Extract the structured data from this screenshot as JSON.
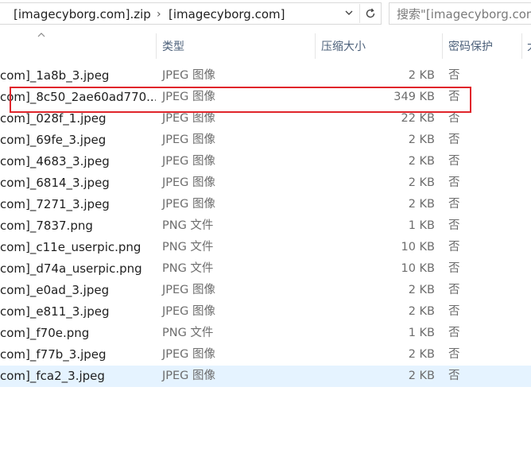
{
  "address_bar": {
    "crumbs": [
      "[imagecyborg.com].zip",
      "[imagecyborg.com]"
    ],
    "separator": "›",
    "dropdown_icon": "chevron-down-icon",
    "refresh_icon": "refresh-icon"
  },
  "search": {
    "placeholder": "搜索\"[imagecyborg.com]\""
  },
  "columns": {
    "type": "类型",
    "compressed_size": "压缩大小",
    "password": "密码保护",
    "extra": "大"
  },
  "files": [
    {
      "name": "com]_1a8b_3.jpeg",
      "type": "JPEG 图像",
      "size": "2 KB",
      "password": "否"
    },
    {
      "name": "com]_8c50_2ae60ad770...",
      "type": "JPEG 图像",
      "size": "349 KB",
      "password": "否"
    },
    {
      "name": "com]_028f_1.jpeg",
      "type": "JPEG 图像",
      "size": "22 KB",
      "password": "否"
    },
    {
      "name": "com]_69fe_3.jpeg",
      "type": "JPEG 图像",
      "size": "2 KB",
      "password": "否"
    },
    {
      "name": "com]_4683_3.jpeg",
      "type": "JPEG 图像",
      "size": "2 KB",
      "password": "否"
    },
    {
      "name": "com]_6814_3.jpeg",
      "type": "JPEG 图像",
      "size": "2 KB",
      "password": "否"
    },
    {
      "name": "com]_7271_3.jpeg",
      "type": "JPEG 图像",
      "size": "2 KB",
      "password": "否"
    },
    {
      "name": "com]_7837.png",
      "type": "PNG 文件",
      "size": "1 KB",
      "password": "否"
    },
    {
      "name": "com]_c11e_userpic.png",
      "type": "PNG 文件",
      "size": "10 KB",
      "password": "否"
    },
    {
      "name": "com]_d74a_userpic.png",
      "type": "PNG 文件",
      "size": "10 KB",
      "password": "否"
    },
    {
      "name": "com]_e0ad_3.jpeg",
      "type": "JPEG 图像",
      "size": "2 KB",
      "password": "否"
    },
    {
      "name": "com]_e811_3.jpeg",
      "type": "JPEG 图像",
      "size": "2 KB",
      "password": "否"
    },
    {
      "name": "com]_f70e.png",
      "type": "PNG 文件",
      "size": "1 KB",
      "password": "否"
    },
    {
      "name": "com]_f77b_3.jpeg",
      "type": "JPEG 图像",
      "size": "2 KB",
      "password": "否"
    },
    {
      "name": "com]_fca2_3.jpeg",
      "type": "JPEG 图像",
      "size": "2 KB",
      "password": "否"
    }
  ],
  "selected_index": 14,
  "highlighted_index": 1,
  "colors": {
    "selection": "#e5f3ff",
    "annotation": "#e0252b",
    "header_text": "#4c607a"
  }
}
